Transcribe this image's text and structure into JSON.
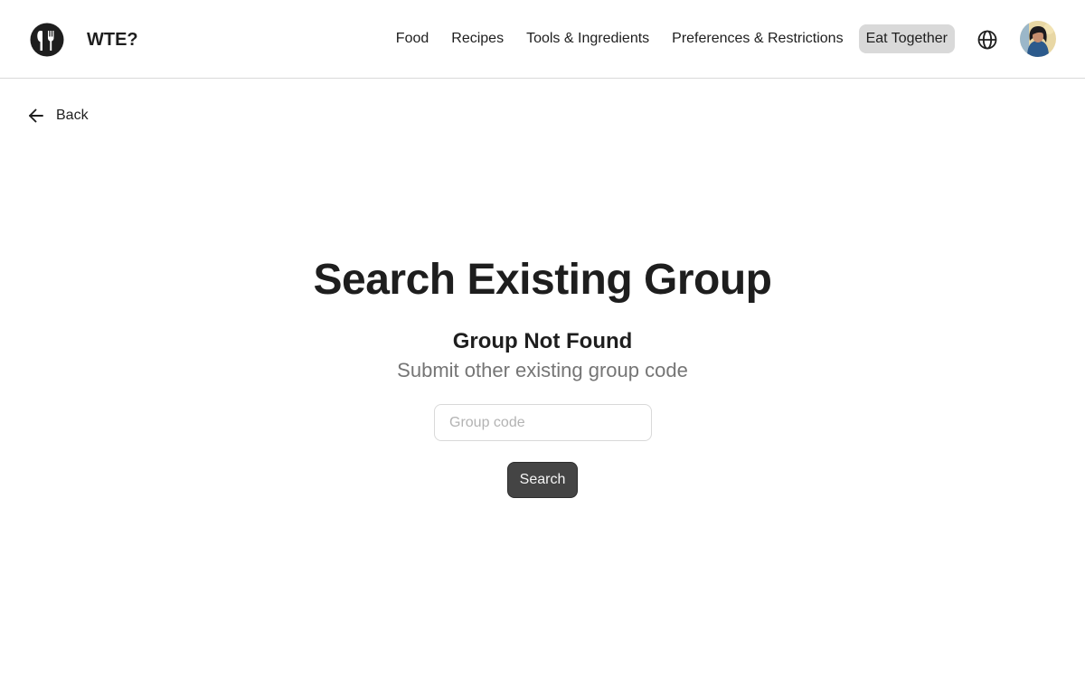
{
  "header": {
    "brand": "WTE?",
    "logo_icon": "fork-knife-logo-icon",
    "nav": [
      {
        "label": "Food",
        "active": false
      },
      {
        "label": "Recipes",
        "active": false
      },
      {
        "label": "Tools & Ingredients",
        "active": false
      },
      {
        "label": "Preferences & Restrictions",
        "active": false
      },
      {
        "label": "Eat Together",
        "active": true
      }
    ],
    "language_icon": "globe-icon",
    "avatar_icon": "user-avatar"
  },
  "back": {
    "label": "Back",
    "icon": "arrow-left-icon"
  },
  "main": {
    "title": "Search Existing Group",
    "status": "Group Not Found",
    "description": "Submit other existing group code",
    "input": {
      "value": "",
      "placeholder": "Group code"
    },
    "search_label": "Search"
  },
  "colors": {
    "text": "#1e1e1e",
    "muted": "#757575",
    "active_nav_bg": "#d9d9d9",
    "button_bg": "#444444",
    "border": "#d9d9d9"
  }
}
